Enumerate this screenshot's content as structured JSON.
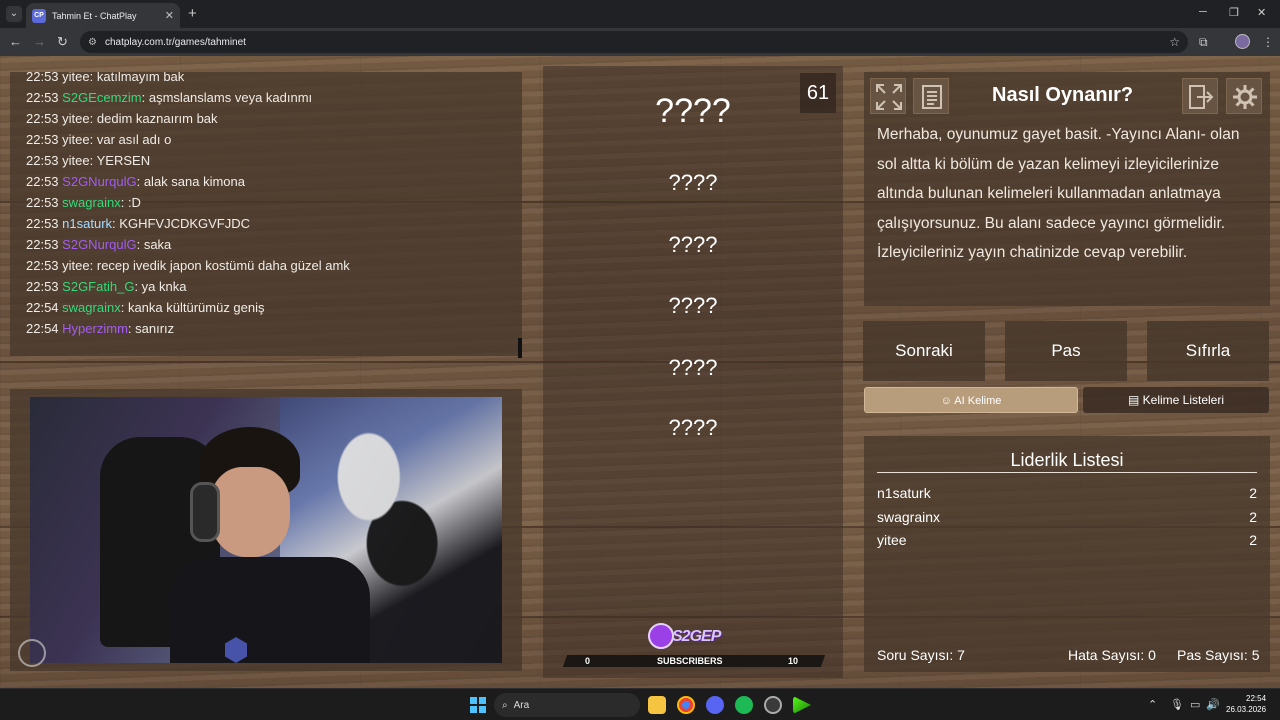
{
  "browser": {
    "tab_title": "Tahmin Et - ChatPlay",
    "favicon_text": "CP",
    "url": "chatplay.com.tr/games/tahminet",
    "icons": [
      "back-icon",
      "forward-icon",
      "reload-icon",
      "site-info-icon",
      "star-icon",
      "extensions-icon",
      "profile-icon"
    ]
  },
  "chat": {
    "messages": [
      {
        "time": "22:53",
        "user": "yitee",
        "text": "katılmayım bak",
        "color": "default"
      },
      {
        "time": "22:53",
        "user": "S2GEcemzim",
        "text": "aşmslanslams veya kadınmı",
        "color": "green"
      },
      {
        "time": "22:53",
        "user": "yitee",
        "text": "dedim kaznaırım bak",
        "color": "default"
      },
      {
        "time": "22:53",
        "user": "yitee",
        "text": "var asıl adı o",
        "color": "default"
      },
      {
        "time": "22:53",
        "user": "yitee",
        "text": "YERSEN",
        "color": "default"
      },
      {
        "time": "22:53",
        "user": "S2GNurqulG",
        "text": "alak sana kimona",
        "color": "purple"
      },
      {
        "time": "22:53",
        "user": "swagrainx",
        "text": ":D",
        "color": "green"
      },
      {
        "time": "22:53",
        "user": "n1saturk",
        "text": "KGHFVJCDKGVFJDC",
        "color": "blue"
      },
      {
        "time": "22:53",
        "user": "S2GNurqulG",
        "text": "saka",
        "color": "purple"
      },
      {
        "time": "22:53",
        "user": "yitee",
        "text": "recep ivedik japon kostümü daha güzel amk",
        "color": "default"
      },
      {
        "time": "22:53",
        "user": "S2GFatih_G",
        "text": "ya knka",
        "color": "green"
      },
      {
        "time": "22:54",
        "user": "swagrainx",
        "text": "kanka kültürümüz geniş",
        "color": "green"
      },
      {
        "time": "22:54",
        "user": "Hyperzimm",
        "text": "sanırız",
        "color": "purple"
      }
    ]
  },
  "game": {
    "timer": "61",
    "words": [
      "????",
      "????",
      "????",
      "????",
      "????",
      "????"
    ],
    "subscribers": {
      "logo": "S2GEP",
      "label": "SUBSCRIBERS",
      "current": "0",
      "goal": "10"
    }
  },
  "howto": {
    "title": "Nasıl Oynanır?",
    "text": "Merhaba, oyunumuz gayet basit. -Yayıncı Alanı- olan sol altta ki bölüm de yazan kelimeyi izleyicilerinize altında bulunan kelimeleri kullanmadan anlatmaya çalışıyorsunuz. Bu alanı sadece yayıncı görmelidir. İzleyicileriniz yayın chatinizde cevap verebilir."
  },
  "actions": {
    "next": "Sonraki",
    "pass": "Pas",
    "reset": "Sıfırla"
  },
  "tabs": {
    "ai_word": "AI Kelime",
    "word_lists": "Kelime Listeleri"
  },
  "leaderboard": {
    "title": "Liderlik Listesi",
    "rows": [
      {
        "name": "n1saturk",
        "score": "2"
      },
      {
        "name": "swagrainx",
        "score": "2"
      },
      {
        "name": "yitee",
        "score": "2"
      }
    ],
    "question_count": "Soru Sayısı: 7",
    "error_count": "Hata Sayısı: 0",
    "pass_count": "Pas Sayısı: 5"
  },
  "taskbar": {
    "search_label": "Ara",
    "time": "22:54",
    "date": "26.03.2026"
  },
  "colors": {
    "green": "#35d97a",
    "purple": "#a35df0",
    "blue": "#a7dcff",
    "default": "#f1ece6"
  }
}
